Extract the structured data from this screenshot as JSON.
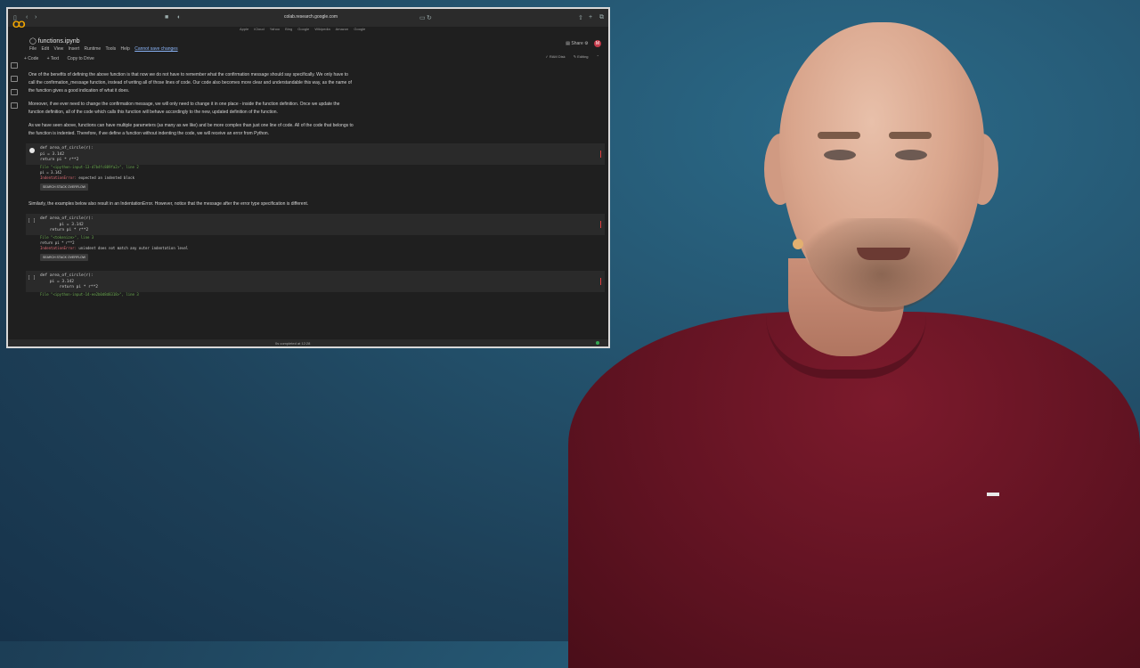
{
  "browser": {
    "url": "colab.research.google.com",
    "bookmarks": [
      "Apple",
      "iCloud",
      "Yahoo",
      "Bing",
      "Google",
      "Wikipedia",
      "Amazon",
      "Google"
    ]
  },
  "notebook": {
    "title": "functions.ipynb",
    "menu": [
      "File",
      "Edit",
      "View",
      "Insert",
      "Runtime",
      "Tools",
      "Help"
    ],
    "save_warning": "Cannot save changes",
    "share_label": "Share",
    "avatar_letter": "M",
    "toolbar": {
      "code": "+ Code",
      "text": "+ Text",
      "copy": "Copy to Drive"
    },
    "editing_label": "Editing",
    "ram_label": "RAM",
    "disk_label": "Disk"
  },
  "content": {
    "para1": "One of the benefits of defining the above function is that now we do not have to remember what the confirmation message should say specifically. We only have to call the confirmation_message function, instead of writing all of those lines of code. Our code also becomes more clear and understandable this way, as the name of the function gives a good indication of what it does.",
    "para2": "Moreover, if we ever need to change the confirmation message, we will only need to change it in one place - inside the function definition. Once we update the function definition, all of the code which calls this function will behave accordingly to the new, updated definition of the function.",
    "para3": "As we have seen above, functions can have multiple parameters (as many as we like) and be more complex than just one line of code. All of the code that belongs to the function is indented. Therefore, if we define a function without indenting the code, we will receive an error from Python.",
    "cell1_code": "def area_of_circle(r):\npi = 3.142\nreturn pi * r**2",
    "out1_file": "File \"<ipython-input-13-d7b4fc889fa2>\", line 2",
    "out1_line": "pi = 3.142",
    "out1_err_type": "IndentationError:",
    "out1_err_msg": " expected an indented block",
    "search_btn": "SEARCH STACK OVERFLOW",
    "para4": "Similarly, the examples below also result in an IndentationError. However, notice that the message after the error type specification is different.",
    "cell2_code": "def area_of_circle(r):\n        pi = 3.142\n    return pi * r**2",
    "out2_file": "File \"<tokenize>\", line 3",
    "out2_line": "return pi * r**2",
    "out2_err_type": "IndentationError:",
    "out2_err_msg": " unindent does not match any outer indentation level",
    "cell3_code": "def area_of_circle(r):\n    pi = 3.142\n        return pi * r**2",
    "out3_file": "File \"<ipython-input-14-ee2b0d8d8318>\", line 3"
  },
  "status": {
    "text": "0s   completed at 12:28"
  }
}
